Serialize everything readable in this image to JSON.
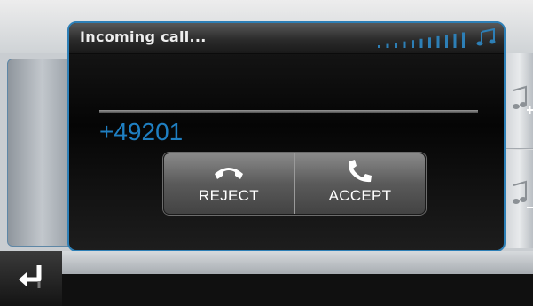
{
  "dialog": {
    "title": "Incoming call...",
    "caller_number": "+49201",
    "signal_bars": 11
  },
  "buttons": {
    "reject_label": "REJECT",
    "accept_label": "ACCEPT"
  },
  "icons": {
    "title_icon": "music-note-icon",
    "reject_icon": "hang-up-phone-icon",
    "accept_icon": "answer-phone-icon",
    "volume_up": "music-note-plus-icon",
    "volume_down": "music-note-minus-icon",
    "back": "back-arrow-icon"
  },
  "colors": {
    "accent": "#2d7fb6",
    "caller_number": "#1f7fc2",
    "dialog_bg": "#0c0c0c"
  }
}
